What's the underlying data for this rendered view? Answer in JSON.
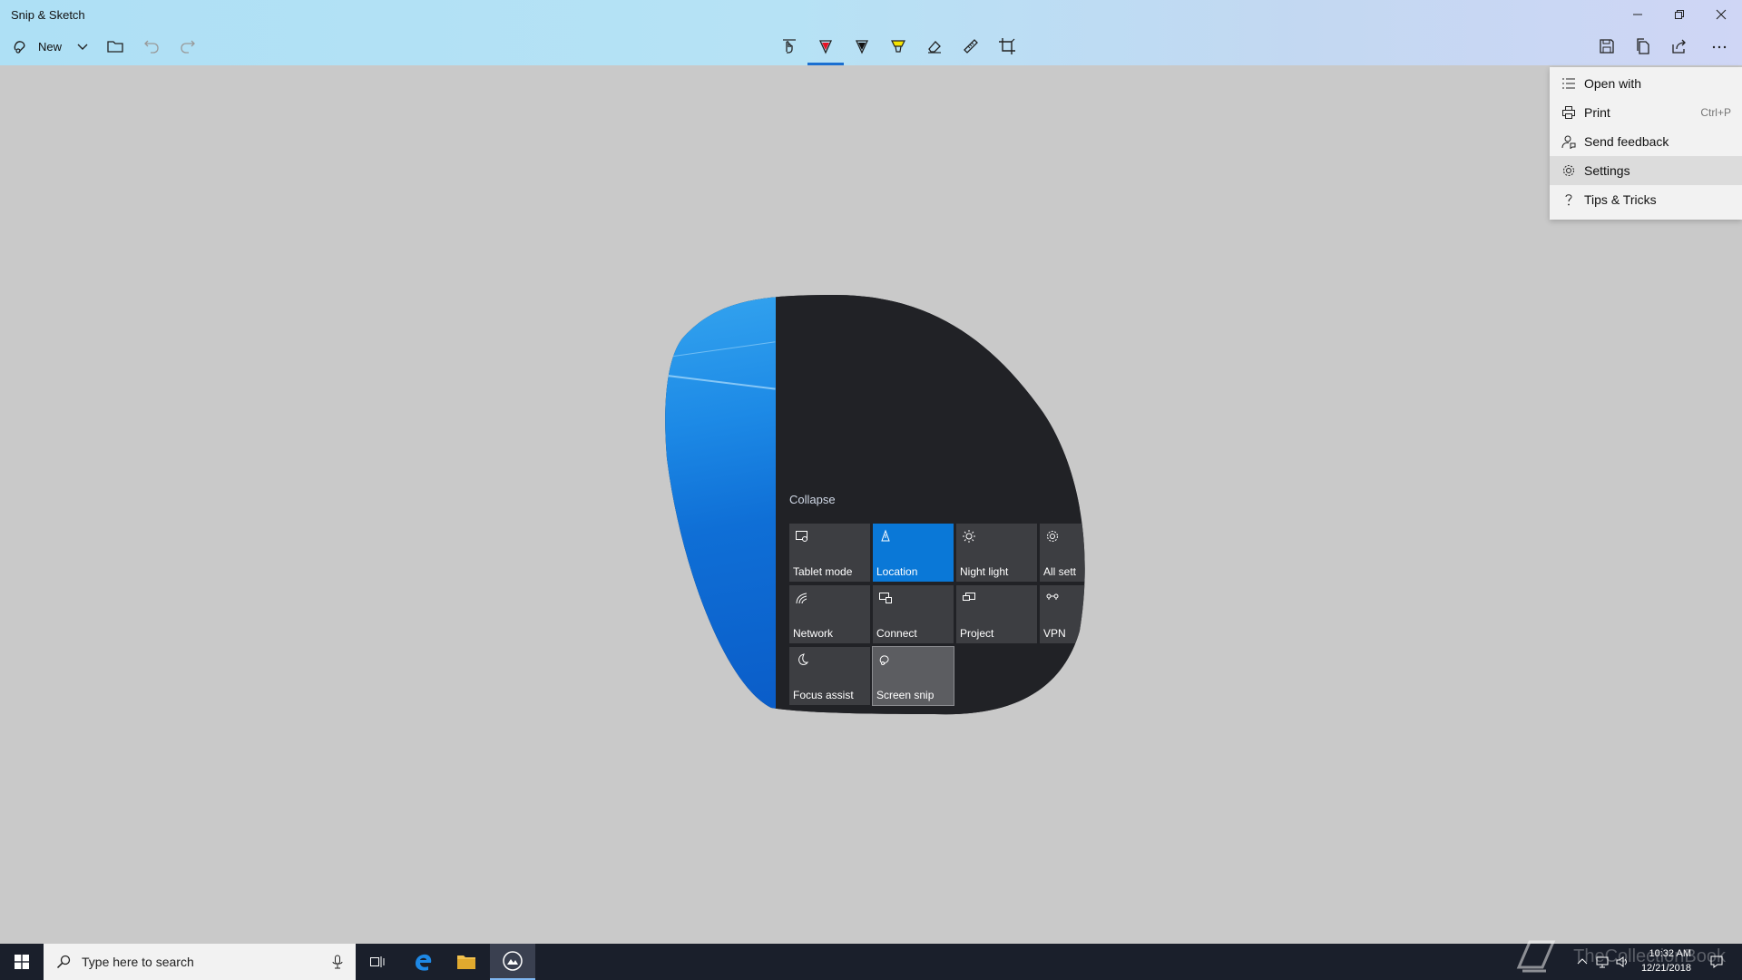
{
  "window": {
    "title": "Snip & Sketch"
  },
  "toolbar": {
    "new_label": "New",
    "tools": [
      "touch-writing-icon",
      "ballpoint-pen-icon",
      "pencil-icon",
      "highlighter-icon",
      "eraser-icon",
      "ruler-icon",
      "crop-icon"
    ],
    "actions": [
      "save-icon",
      "copy-icon",
      "share-icon",
      "more-icon"
    ]
  },
  "menu": {
    "items": [
      {
        "label": "Open with",
        "icon": "open-with-icon",
        "shortcut": ""
      },
      {
        "label": "Print",
        "icon": "print-icon",
        "shortcut": "Ctrl+P"
      },
      {
        "label": "Send feedback",
        "icon": "feedback-icon",
        "shortcut": ""
      },
      {
        "label": "Settings",
        "icon": "gear-icon",
        "shortcut": ""
      },
      {
        "label": "Tips & Tricks",
        "icon": "question-icon",
        "shortcut": ""
      }
    ]
  },
  "snip": {
    "collapse_label": "Collapse",
    "tiles": [
      {
        "label": "Tablet mode",
        "icon": "tablet-mode-icon"
      },
      {
        "label": "Location",
        "icon": "location-icon"
      },
      {
        "label": "Night light",
        "icon": "night-light-icon"
      },
      {
        "label": "All sett",
        "icon": "gear-icon"
      },
      {
        "label": "Network",
        "icon": "network-icon"
      },
      {
        "label": "Connect",
        "icon": "connect-icon"
      },
      {
        "label": "Project",
        "icon": "project-icon"
      },
      {
        "label": "VPN",
        "icon": "vpn-icon"
      },
      {
        "label": "Focus assist",
        "icon": "moon-icon"
      },
      {
        "label": "Screen snip",
        "icon": "screen-snip-icon"
      }
    ]
  },
  "taskbar": {
    "search_placeholder": "Type here to search",
    "time": "10:32 AM",
    "date": "12/21/2018",
    "watermark": "TheCollectionBook"
  },
  "colors": {
    "accent": "#0a78d7",
    "titlebar": "#b6e2f5",
    "canvas": "#c9c9c9",
    "taskbar": "#1a1f2b"
  }
}
